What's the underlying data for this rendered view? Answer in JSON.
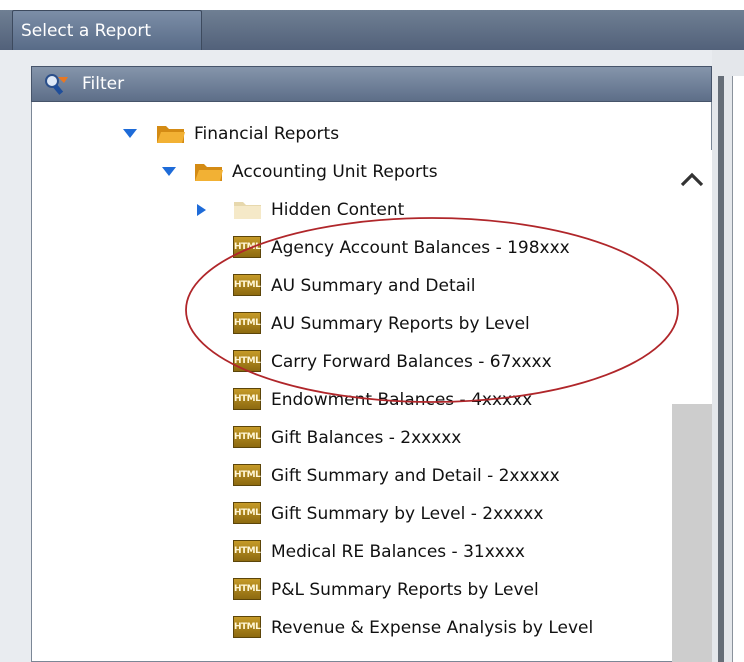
{
  "header": {
    "tab_label": "Select a Report"
  },
  "filter": {
    "label": "Filter"
  },
  "tree": {
    "items": [
      {
        "label": "Financial Reports",
        "type": "folder",
        "state": "expanded"
      },
      {
        "label": "Accounting Unit Reports",
        "type": "folder",
        "state": "expanded"
      },
      {
        "label": "Hidden Content",
        "type": "folder-empty",
        "state": "collapsed"
      },
      {
        "label": "Agency Account Balances - 198xxx",
        "type": "html-report"
      },
      {
        "label": "AU Summary and Detail",
        "type": "html-report"
      },
      {
        "label": "AU Summary Reports by Level",
        "type": "html-report"
      },
      {
        "label": "Carry Forward Balances - 67xxxx",
        "type": "html-report"
      },
      {
        "label": "Endowment Balances - 4xxxxx",
        "type": "html-report"
      },
      {
        "label": "Gift Balances - 2xxxxx",
        "type": "html-report"
      },
      {
        "label": "Gift Summary and Detail - 2xxxxx",
        "type": "html-report"
      },
      {
        "label": "Gift Summary by Level - 2xxxxx",
        "type": "html-report"
      },
      {
        "label": "Medical RE Balances - 31xxxx",
        "type": "html-report"
      },
      {
        "label": "P&L Summary Reports by Level",
        "type": "html-report"
      },
      {
        "label": "Revenue & Expense Analysis by Level",
        "type": "html-report"
      }
    ],
    "html_icon_text": "HTML"
  },
  "colors": {
    "header_bg": "#5d6e88",
    "expander": "#1e6bd8",
    "folder": "#f2b134",
    "annotation": "#b0262a",
    "scroll_thumb": "#cdcdcd"
  }
}
